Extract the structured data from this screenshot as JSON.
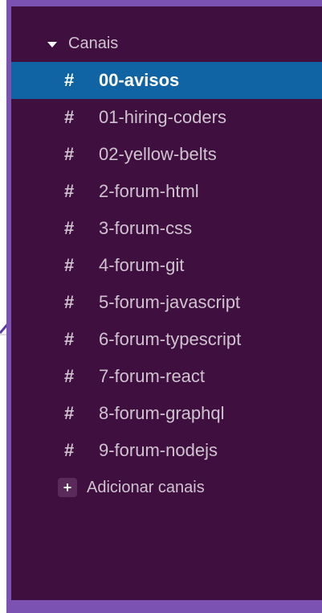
{
  "sidebar": {
    "section_title": "Canais",
    "section_icon": "caret-down-icon",
    "channel_prefix": "#",
    "channels": [
      {
        "name": "00-avisos",
        "active": true
      },
      {
        "name": "01-hiring-coders",
        "active": false
      },
      {
        "name": "02-yellow-belts",
        "active": false
      },
      {
        "name": "2-forum-html",
        "active": false
      },
      {
        "name": "3-forum-css",
        "active": false
      },
      {
        "name": "4-forum-git",
        "active": false
      },
      {
        "name": "5-forum-javascript",
        "active": false
      },
      {
        "name": "6-forum-typescript",
        "active": false
      },
      {
        "name": "7-forum-react",
        "active": false
      },
      {
        "name": "8-forum-graphql",
        "active": false
      },
      {
        "name": "9-forum-nodejs",
        "active": false
      }
    ],
    "add_label": "Adicionar canais",
    "add_icon": "+"
  },
  "colors": {
    "frame": "#7b52b2",
    "sidebar_bg": "#3f0f3f",
    "active_bg": "#1164a3",
    "text": "#cfc3cf"
  }
}
